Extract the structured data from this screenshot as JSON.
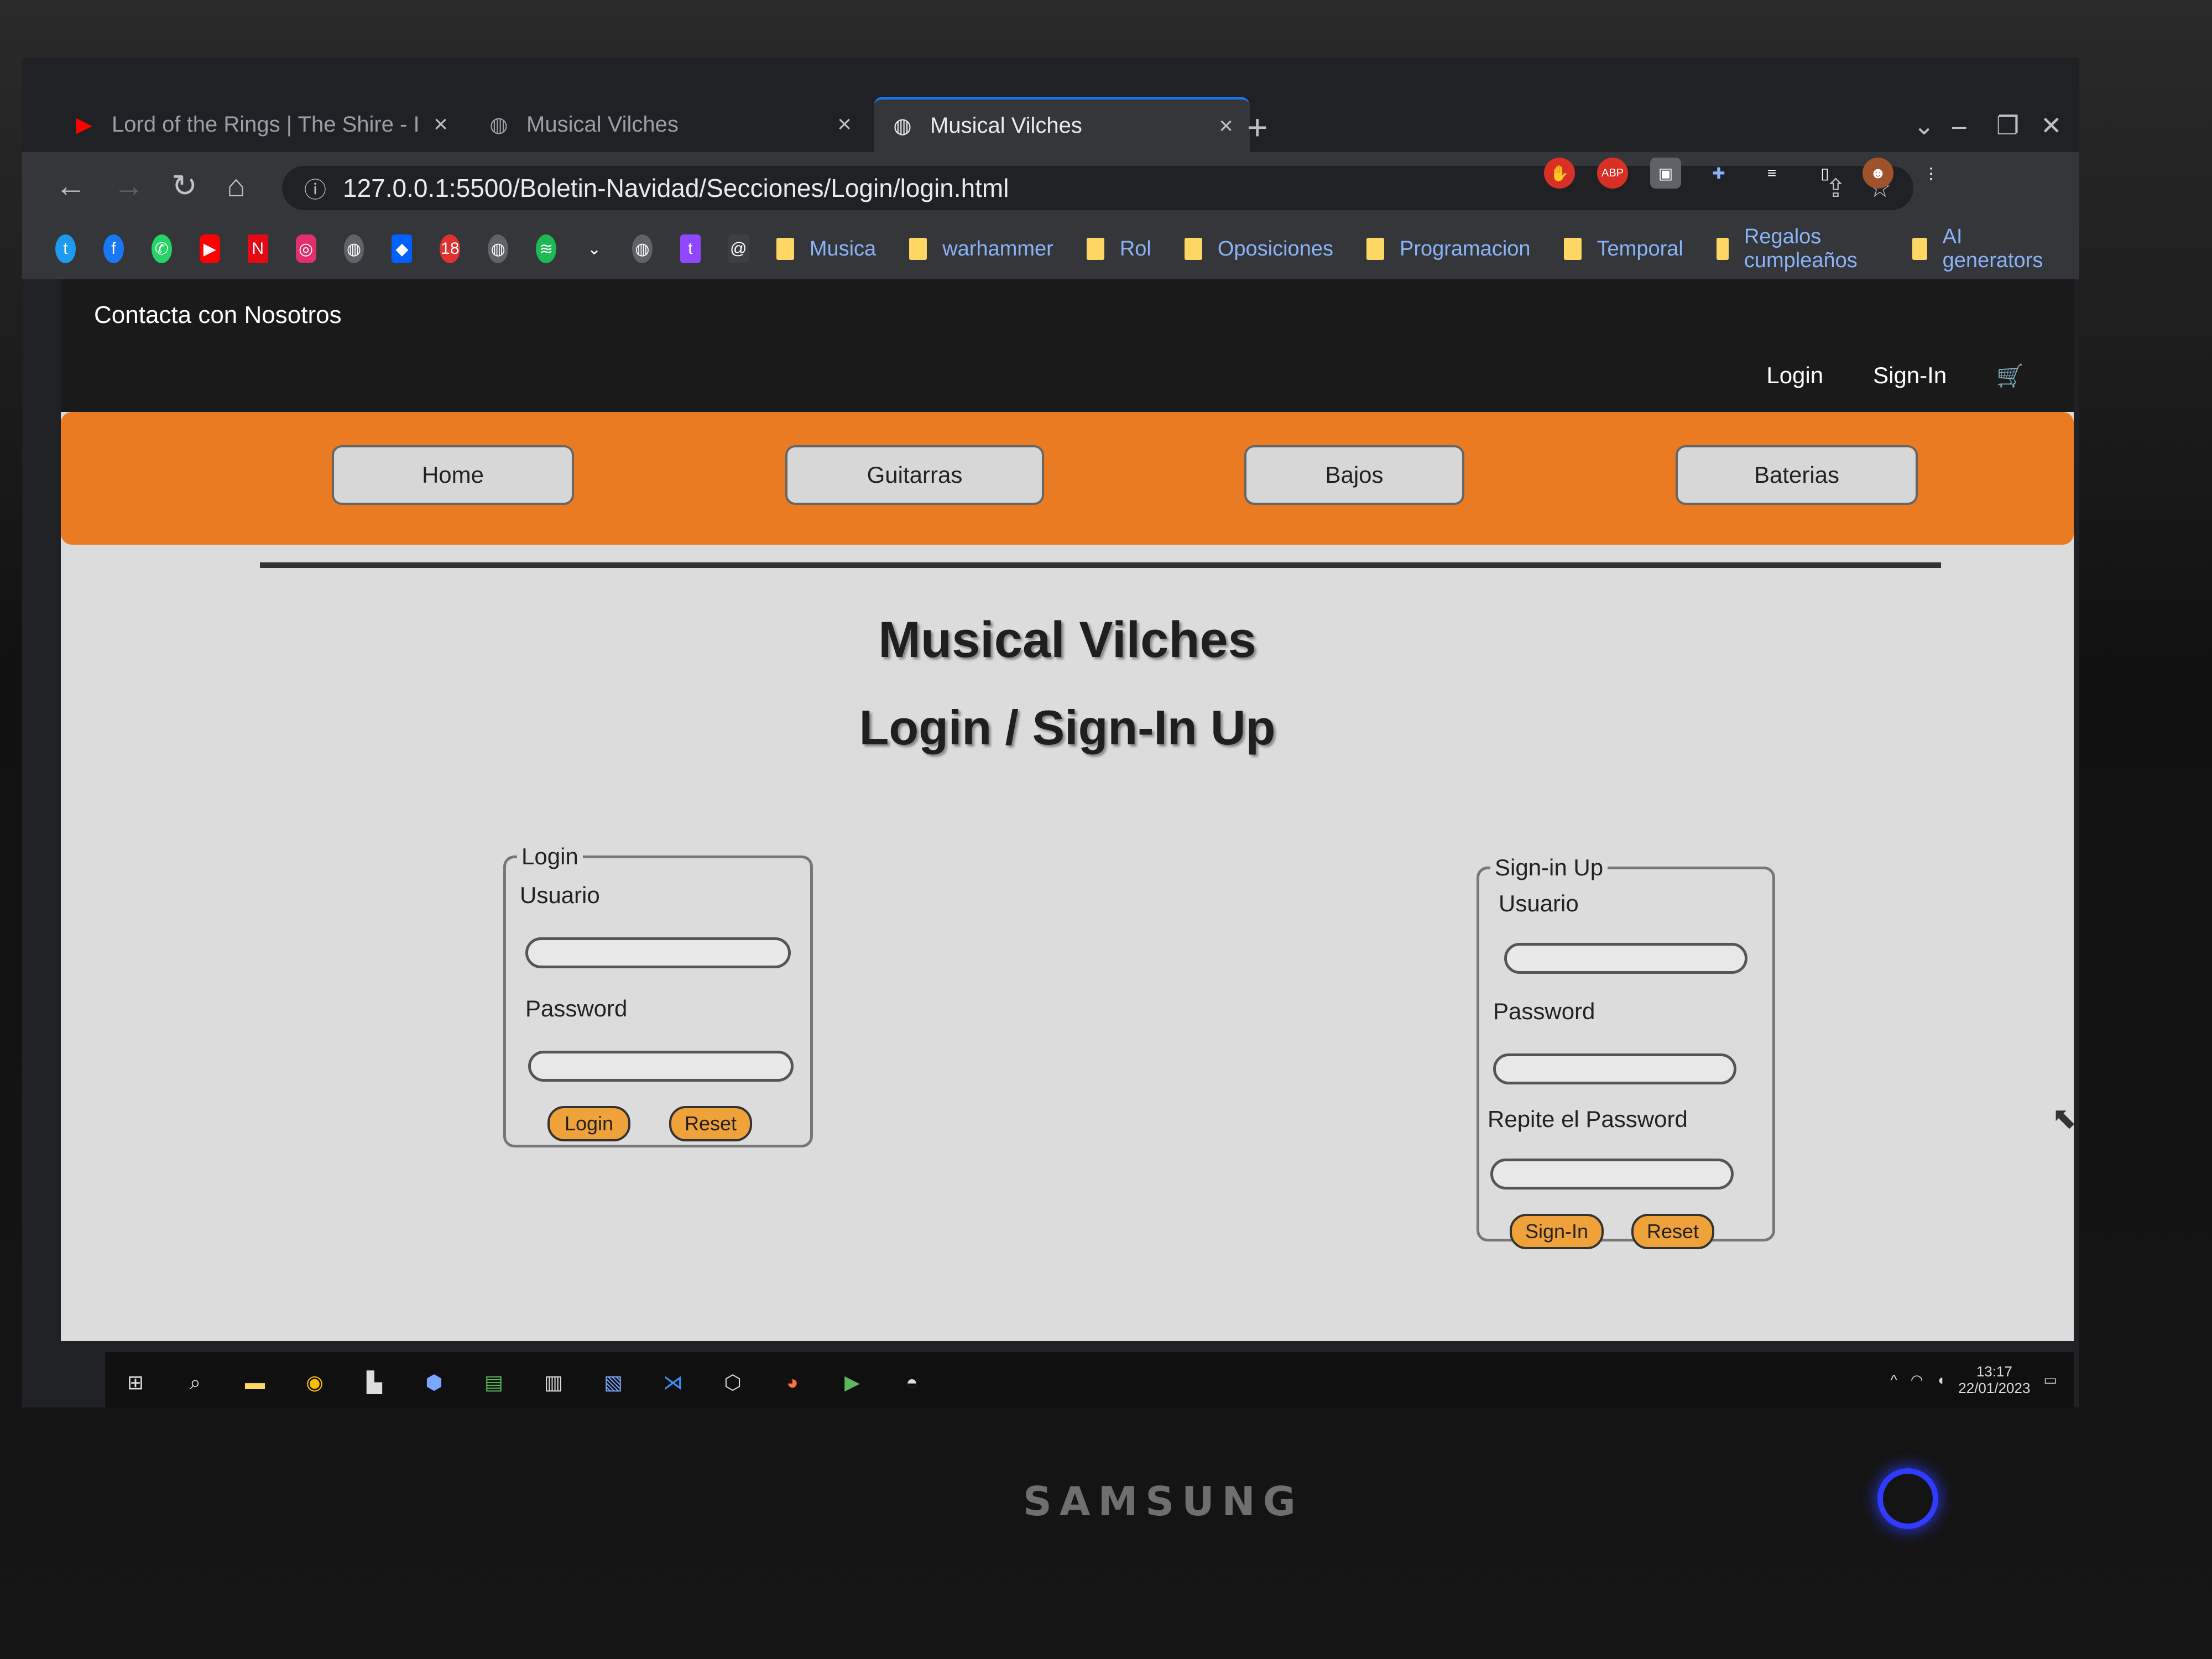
{
  "browser": {
    "tabs": [
      {
        "label": "Lord of the Rings | The Shire - I",
        "favicon": "youtube-icon"
      },
      {
        "label": "Musical Vilches",
        "favicon": "globe-icon"
      },
      {
        "label": "Musical Vilches",
        "favicon": "globe-icon",
        "active": true
      }
    ],
    "url": "127.0.0.1:5500/Boletin-Navidad/Secciones/Login/login.html",
    "bookmark_folders": [
      "Musica",
      "warhammer",
      "Rol",
      "Oposiciones",
      "Programacion",
      "Temporal",
      "Regalos cumpleaños",
      "AI generators"
    ]
  },
  "site": {
    "contact_link": "Contacta con Nosotros",
    "login_link": "Login",
    "signin_link": "Sign-In",
    "menu": [
      "Home",
      "Guitarras",
      "Bajos",
      "Baterias"
    ],
    "title": "Musical Vilches",
    "subtitle": "Login / Sign-In Up",
    "accent_color": "#ea7b22"
  },
  "login_form": {
    "legend": "Login",
    "user_label": "Usuario",
    "password_label": "Password",
    "submit_label": "Login",
    "reset_label": "Reset"
  },
  "signup_form": {
    "legend": "Sign-in Up",
    "user_label": "Usuario",
    "password_label": "Password",
    "repeat_label": "Repite el Password",
    "submit_label": "Sign-In",
    "reset_label": "Reset"
  },
  "taskbar": {
    "time": "13:17",
    "date": "22/01/2023"
  },
  "monitor": {
    "brand": "SAMSUNG"
  }
}
